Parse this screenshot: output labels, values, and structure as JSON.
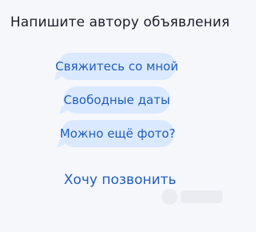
{
  "header": {
    "title": "Напишите автору объявления"
  },
  "quick_messages": [
    {
      "label": "Свяжитесь со мной"
    },
    {
      "label": "Свободные даты"
    },
    {
      "label": "Можно ещё фото?"
    }
  ],
  "actions": {
    "call_label": "Хочу позвонить"
  },
  "theme": {
    "bubble_bg": "#dbe9ff",
    "bubble_text": "#1f5fbf",
    "link_text": "#1f5fbf"
  }
}
